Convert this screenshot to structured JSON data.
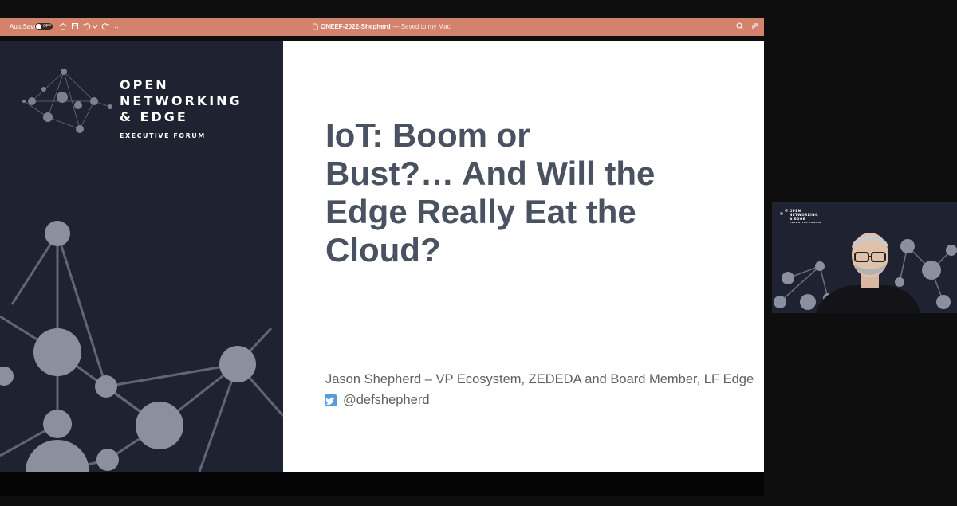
{
  "toolbar": {
    "autosave_label": "AutoSave",
    "autosave_state": "OFF",
    "doc_name": "ONEEF-2022-Shepherd",
    "doc_status": "— Saved to my Mac",
    "more": "···",
    "icons": [
      "home-icon",
      "save-icon",
      "undo-icon",
      "redo-icon",
      "more-icon",
      "document-icon",
      "search-icon",
      "share-icon"
    ]
  },
  "slide": {
    "brand_line1": "OPEN",
    "brand_line2": "NETWORKING",
    "brand_line3": "& EDGE",
    "brand_sub": "EXECUTIVE FORUM",
    "title_line1": "IoT: Boom or",
    "title_line2": "Bust?… And Will the",
    "title_line3": "Edge Really Eat the",
    "title_line4": "Cloud?",
    "presenter": "Jason Shepherd – VP Ecosystem, ZEDEDA and Board Member, LF Edge",
    "handle": "@defshepherd"
  },
  "video": {
    "brand_line1": "OPEN",
    "brand_line2": "NETWORKING",
    "brand_line3": "& EDGE",
    "brand_sub": "EXECUTIVE FORUM"
  },
  "colors": {
    "toolbar_bg": "#d3826b",
    "slide_dark": "#1f2230",
    "title_color": "#4a5262",
    "twitter_blue": "#5b9bd5"
  }
}
